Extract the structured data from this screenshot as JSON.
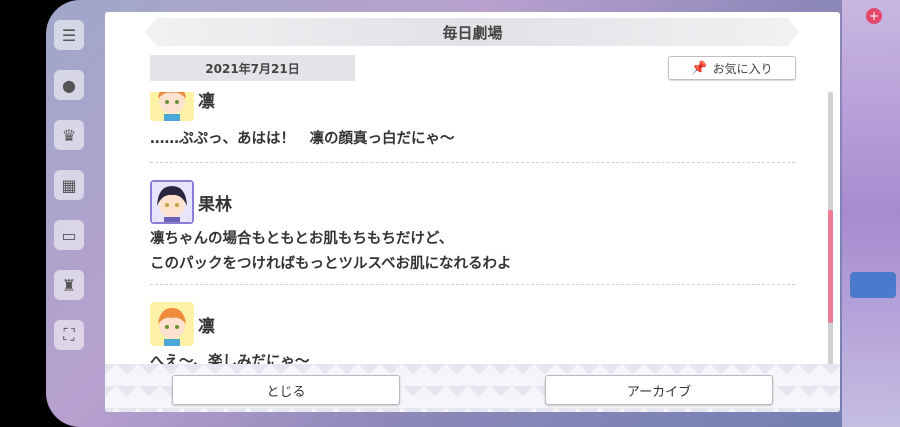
{
  "dialog": {
    "title": "毎日劇場",
    "date": "2021年7月21日",
    "favorite_label": "お気に入り"
  },
  "entries": [
    {
      "speaker": "凛",
      "lines": [
        "……ぷぷっ、あはは！　凛の顔真っ白だにゃ〜"
      ]
    },
    {
      "speaker": "果林",
      "lines": [
        "凛ちゃんの場合もともとお肌もちもちだけど、",
        "このパックをつければもっとツルスベお肌になれるわよ"
      ]
    },
    {
      "speaker": "凛",
      "lines": [
        "へえ〜、楽しみだにゃ〜"
      ]
    }
  ],
  "buttons": {
    "close_label": "とじる",
    "archive_label": "アーカイブ"
  },
  "colors": {
    "scroll_thumb": "#ef7c95",
    "rin_hair": "#f08a3c",
    "karin_hair": "#2a2540"
  }
}
